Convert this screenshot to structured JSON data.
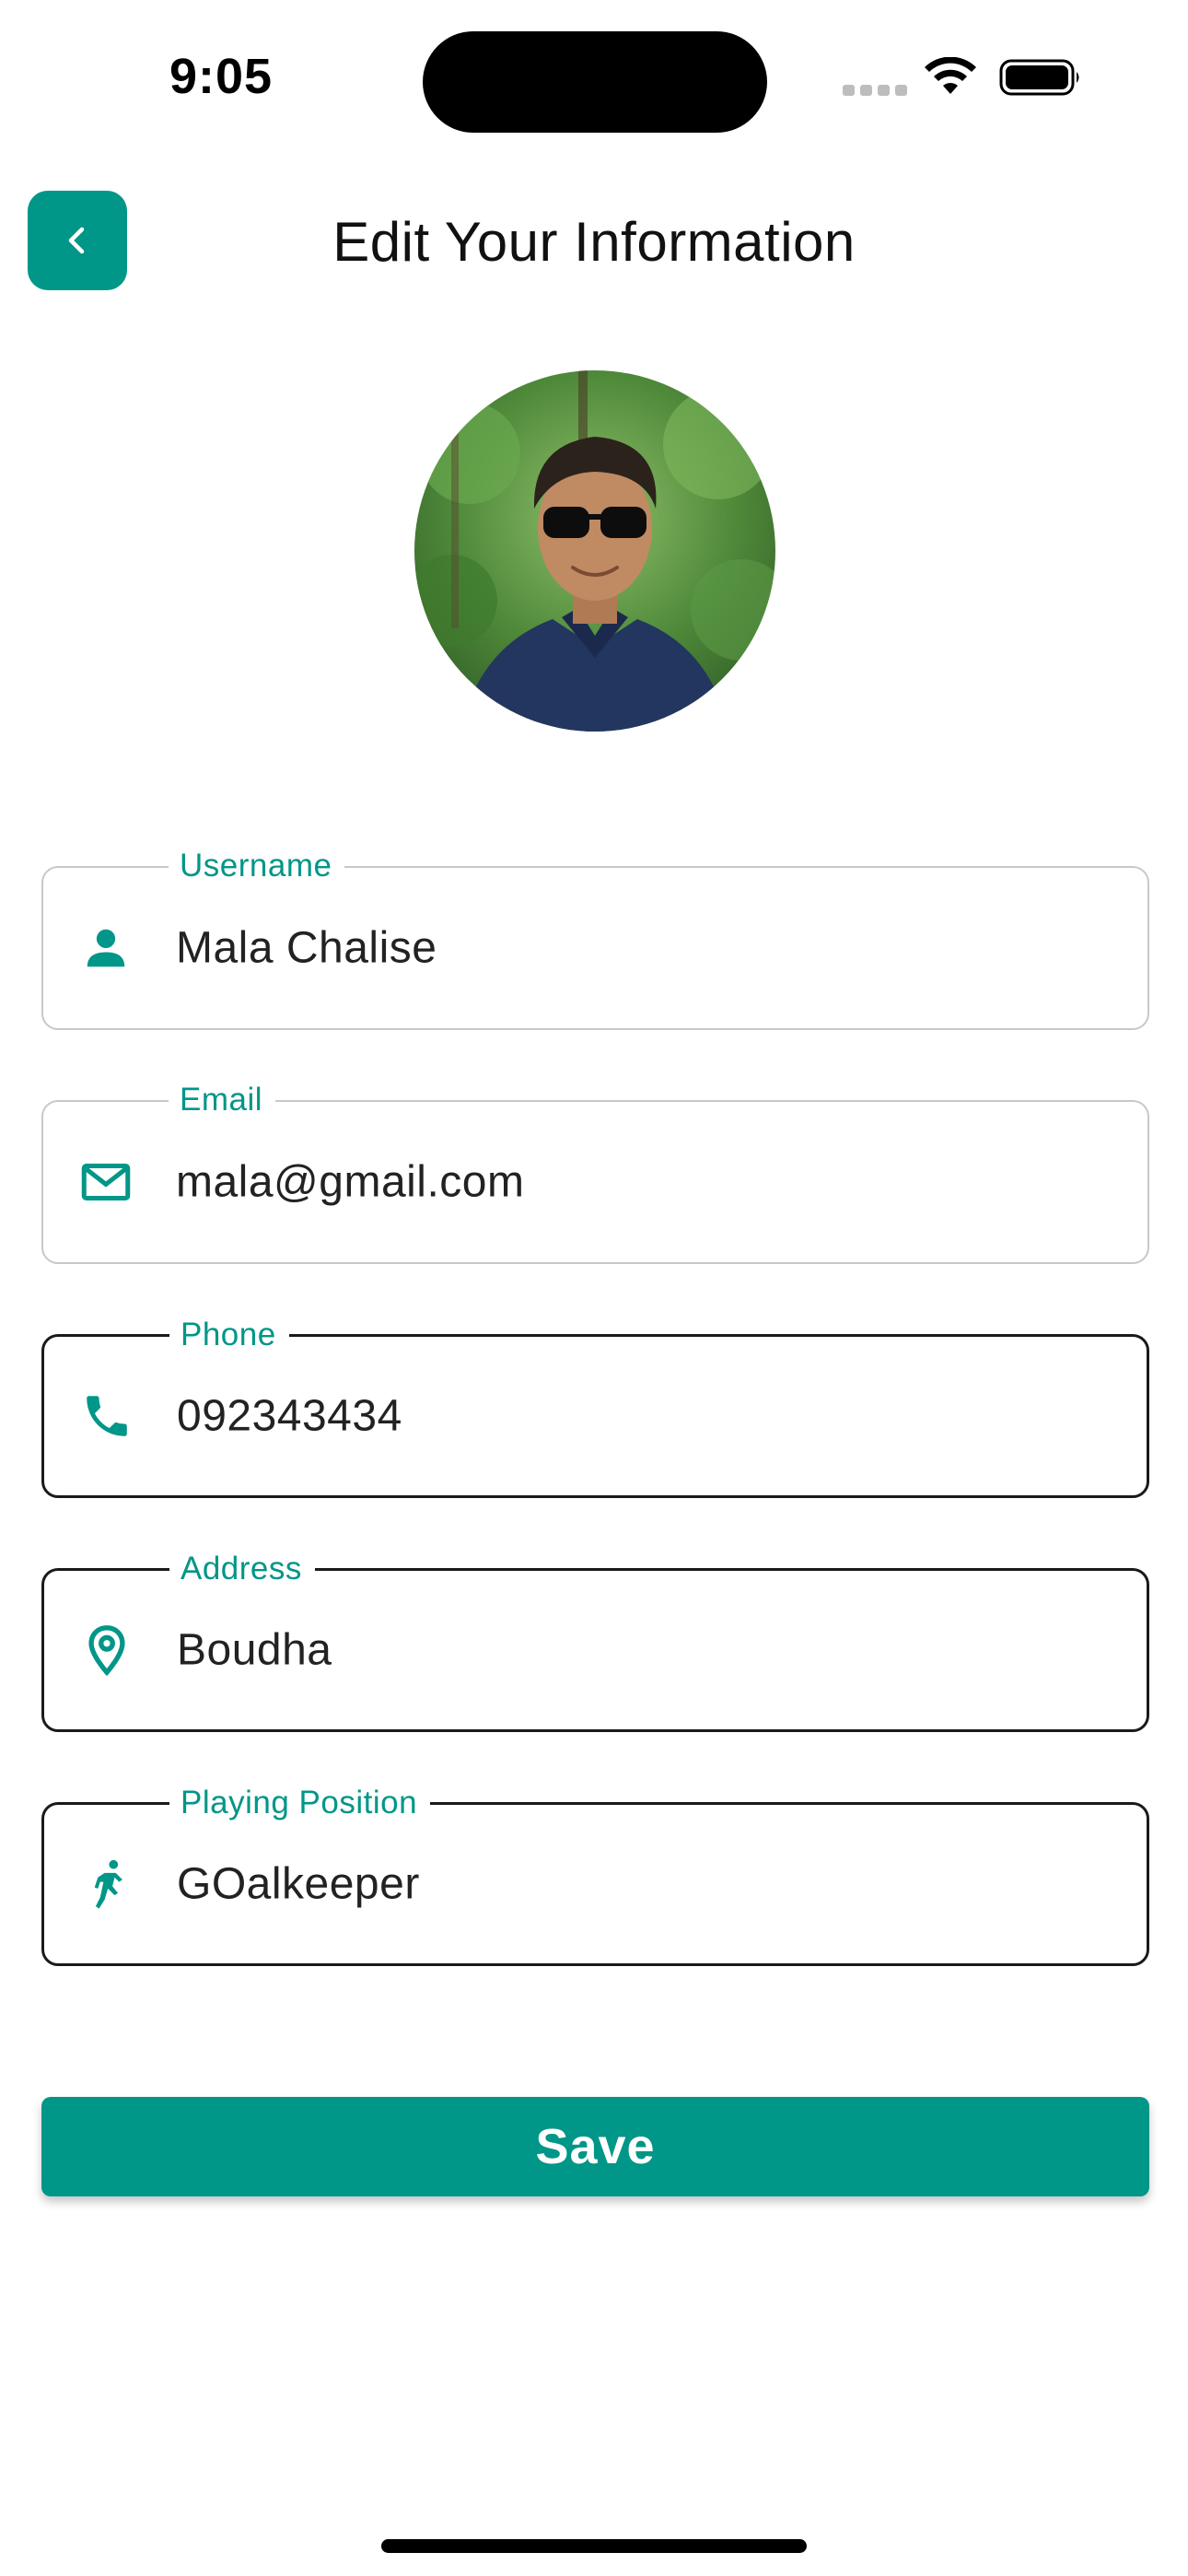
{
  "status_bar": {
    "time": "9:05"
  },
  "header": {
    "title": "Edit Your Information",
    "back_icon": "chevron-left-icon"
  },
  "avatar": {
    "alt": "Profile photo"
  },
  "fields": {
    "username": {
      "label": "Username",
      "value": "Mala Chalise",
      "icon": "person-icon"
    },
    "email": {
      "label": "Email",
      "value": "mala@gmail.com",
      "icon": "mail-icon"
    },
    "phone": {
      "label": "Phone",
      "value": "092343434",
      "icon": "phone-icon"
    },
    "address": {
      "label": "Address",
      "value": "Boudha",
      "icon": "location-pin-icon"
    },
    "playing_position": {
      "label": "Playing Position",
      "value": "GOalkeeper",
      "icon": "player-icon"
    }
  },
  "save_button": {
    "label": "Save"
  },
  "colors": {
    "accent": "#009688",
    "inactive_border": "#c8c8c8",
    "active_border": "#1a1a1a"
  }
}
